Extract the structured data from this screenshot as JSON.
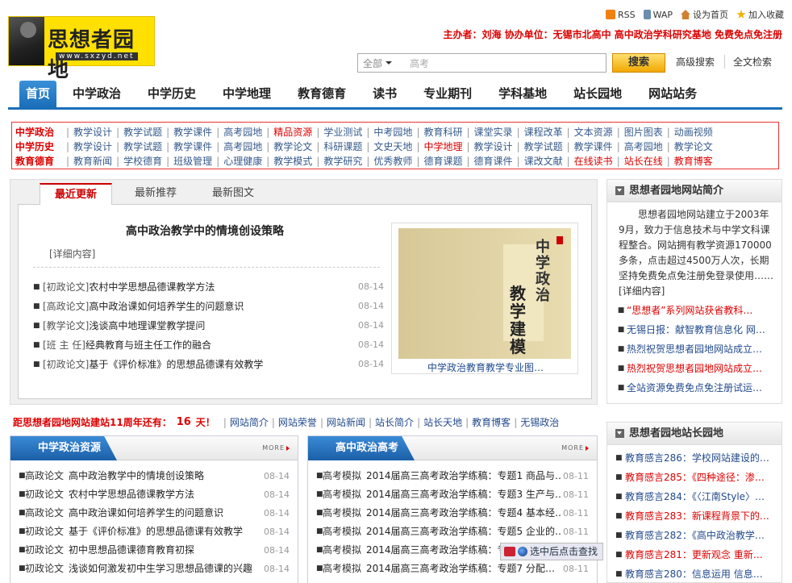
{
  "header": {
    "logo_text": "思想者园地",
    "logo_domain": "www.sxzyd.net",
    "toplinks": [
      {
        "icon": "rss-icon",
        "label": "RSS"
      },
      {
        "icon": "wap-icon",
        "label": "WAP"
      },
      {
        "icon": "home-icon",
        "label": "设为首页"
      },
      {
        "icon": "star-icon",
        "label": "加入收藏"
      }
    ],
    "sponsor": "主办者：刘海  协办单位：无锡市北高中  高中政治学科研究基地  免费免点免注册",
    "search": {
      "scope": "全部",
      "keyword": "高考",
      "button": "搜索",
      "advanced": "高级搜索",
      "fulltext": "全文检索"
    }
  },
  "nav": [
    "首页",
    "中学政治",
    "中学历史",
    "中学地理",
    "教育德育",
    "读书",
    "专业期刊",
    "学科基地",
    "站长园地",
    "网站站务"
  ],
  "cats": [
    {
      "head": "中学政治",
      "items": [
        {
          "t": "教学设计"
        },
        {
          "t": "教学试题"
        },
        {
          "t": "教学课件"
        },
        {
          "t": "高考园地"
        },
        {
          "t": "精品资源",
          "red": true
        },
        {
          "t": "学业测试"
        },
        {
          "t": "中考园地"
        },
        {
          "t": "教育科研"
        },
        {
          "t": "课堂实录"
        },
        {
          "t": "课程改革"
        },
        {
          "t": "文本资源"
        },
        {
          "t": "图片图表"
        },
        {
          "t": "动画视频"
        }
      ]
    },
    {
      "head": "中学历史",
      "items": [
        {
          "t": "教学设计"
        },
        {
          "t": "教学试题"
        },
        {
          "t": "教学课件"
        },
        {
          "t": "高考园地"
        },
        {
          "t": "教学论文"
        },
        {
          "t": "科研课题"
        },
        {
          "t": "文史天地"
        },
        {
          "t": "中学地理",
          "red": true
        },
        {
          "t": "教学设计"
        },
        {
          "t": "教学试题"
        },
        {
          "t": "教学课件"
        },
        {
          "t": "高考园地"
        },
        {
          "t": "教学论文"
        }
      ]
    },
    {
      "head": "教育德育",
      "items": [
        {
          "t": "教育新闻"
        },
        {
          "t": "学校德育"
        },
        {
          "t": "班级管理"
        },
        {
          "t": "心理健康"
        },
        {
          "t": "教学模式"
        },
        {
          "t": "教学研究"
        },
        {
          "t": "优秀教师"
        },
        {
          "t": "德育课题"
        },
        {
          "t": "德育课件"
        },
        {
          "t": "课改文献"
        },
        {
          "t": "在线读书",
          "red": true
        },
        {
          "t": "站长在线",
          "red": true
        },
        {
          "t": "教育博客",
          "red": true
        }
      ]
    }
  ],
  "latest": {
    "tabs": [
      "最近更新",
      "最新推荐",
      "最新图文"
    ],
    "headline": "高中政治教学中的情境创设策略",
    "detail": "[详细内容]",
    "list": [
      {
        "tag": "[初政论文]",
        "title": "农村中学思想品德课教学方法",
        "date": "08-14"
      },
      {
        "tag": "[高政论文]",
        "title": "高中政治课如何培养学生的问题意识",
        "date": "08-14"
      },
      {
        "tag": "[教学论文]",
        "title": "浅谈高中地理课堂教学提问",
        "date": "08-14"
      },
      {
        "tag": "[班 主 任]",
        "title": "经典教育与班主任工作的融合",
        "date": "08-14"
      },
      {
        "tag": "[初政论文]",
        "title": "基于《评价标准》的思想品德课有效教学",
        "date": "08-14"
      }
    ],
    "book": {
      "title1": "中学政治",
      "title2": "教学建模",
      "caption": "中学政治教育教学专业图…"
    }
  },
  "intro": {
    "title": "思想者园地网站简介",
    "text": "思想者园地网站建立于2003年9月，致力于信息技术与中学文科课程整合。网站拥有教学资源170000多条，点击超过4500万人次，长期坚持免费免点免注册免登录使用……[详细内容]",
    "links": [
      {
        "t": "“思想者”系列网站获省教科…",
        "red": true
      },
      {
        "t": "无锡日报：献智教育信息化 网…",
        "red": false
      },
      {
        "t": "热烈祝贺思想者园地网站成立…",
        "red": false
      },
      {
        "t": "热烈祝贺思想者园地网站成立…",
        "red": true
      },
      {
        "t": "全站资源免费免点免注册试运…",
        "red": false
      }
    ]
  },
  "master": {
    "title": "思想者园地站长园地",
    "links": [
      {
        "t": "教育感言286：学校网站建设的…",
        "red": false
      },
      {
        "t": "教育感言285：《四种途径：渗…",
        "red": true
      },
      {
        "t": "教育感言284：《〈江南Style〉…",
        "red": false
      },
      {
        "t": "教育感言283：新课程背景下的…",
        "red": true
      },
      {
        "t": "教育感言282：《高中政治教学…",
        "red": false
      },
      {
        "t": "教育感言281：更新观念 重新…",
        "red": true
      },
      {
        "t": "教育感言280：信息运用 信息…",
        "red": false
      }
    ]
  },
  "countdown": {
    "label": "距思想者园地网站建站11周年还有：",
    "days": "16",
    "unit": "天！",
    "links": [
      "网站简介",
      "网站荣誉",
      "网站新闻",
      "站长简介",
      "站长天地",
      "教育博客",
      "无锡政治"
    ]
  },
  "pane1": {
    "title": "中学政治资源",
    "more": "MORE",
    "rows": [
      {
        "tag": "高政论文",
        "t": "高中政治教学中的情境创设策略",
        "d": "08-14"
      },
      {
        "tag": "初政论文",
        "t": "农村中学思想品德课教学方法",
        "d": "08-14"
      },
      {
        "tag": "高政论文",
        "t": "高中政治课如何培养学生的问题意识",
        "d": "08-14"
      },
      {
        "tag": "初政论文",
        "t": "基于《评价标准》的思想品德课有效教学",
        "d": "08-14"
      },
      {
        "tag": "初政论文",
        "t": "初中思想品德课德育教育初探",
        "d": "08-14"
      },
      {
        "tag": "初政论文",
        "t": "浅谈如何激发初中生学习思想品德课的兴趣",
        "d": "08-14"
      }
    ]
  },
  "pane2": {
    "title": "高中政治高考",
    "more": "MORE",
    "rows": [
      {
        "tag": "高考模拟",
        "t": "2014届高三高考政治学练稿：专题1 商品与…",
        "d": "08-11"
      },
      {
        "tag": "高考模拟",
        "t": "2014届高三高考政治学练稿：专题3 生产与…",
        "d": "08-11"
      },
      {
        "tag": "高考模拟",
        "t": "2014届高三高考政治学练稿：专题4 基本经…",
        "d": "08-11"
      },
      {
        "tag": "高考模拟",
        "t": "2014届高三高考政治学练稿：专题5 企业的…",
        "d": "08-11"
      },
      {
        "tag": "高考模拟",
        "t": "2014届高三高考政治学练稿：专",
        "d": ""
      },
      {
        "tag": "高考模拟",
        "t": "2014届高三高考政治学练稿：专题7 分配…",
        "d": "08-11"
      }
    ]
  },
  "helper": {
    "label": "选中后点击查找"
  }
}
